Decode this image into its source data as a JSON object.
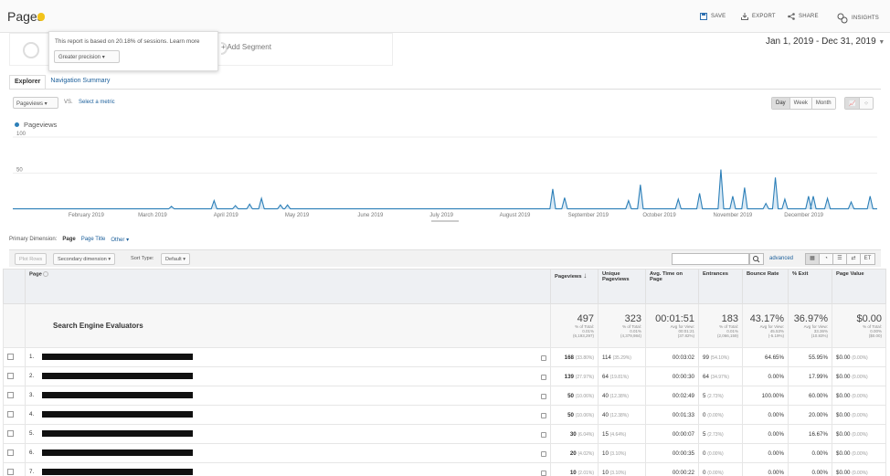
{
  "header": {
    "title": "Pages",
    "actions": [
      "SAVE",
      "EXPORT",
      "SHARE",
      "INSIGHTS"
    ]
  },
  "segment": {
    "popup_text": "This report is based on 20.18% of sessions. Learn more",
    "precision_label": "Greater precision",
    "add_segment": "+ Add Segment"
  },
  "date_range": "Jan 1, 2019 - Dec 31, 2019",
  "tabs": [
    "Explorer",
    "Navigation Summary"
  ],
  "metric_select": {
    "value": "Pageviews",
    "vs": "VS.",
    "select_metric": "Select a metric"
  },
  "time_buttons": [
    "Day",
    "Week",
    "Month"
  ],
  "legend": "Pageviews",
  "chart_data": {
    "type": "line",
    "series": [
      {
        "name": "Pageviews"
      }
    ],
    "ylim": [
      0,
      100
    ],
    "yticks": [
      "100",
      "50"
    ],
    "month_labels": [
      "February 2019",
      "March 2019",
      "April 2019",
      "May 2019",
      "June 2019",
      "July 2019",
      "August 2019",
      "September 2019",
      "October 2019",
      "November 2019",
      "December 2019"
    ],
    "spikes": [
      {
        "day": 67,
        "value": 4
      },
      {
        "day": 85,
        "value": 12
      },
      {
        "day": 94,
        "value": 5
      },
      {
        "day": 100,
        "value": 7
      },
      {
        "day": 105,
        "value": 15
      },
      {
        "day": 113,
        "value": 6
      },
      {
        "day": 116,
        "value": 6
      },
      {
        "day": 228,
        "value": 28
      },
      {
        "day": 233,
        "value": 16
      },
      {
        "day": 260,
        "value": 12
      },
      {
        "day": 265,
        "value": 34
      },
      {
        "day": 281,
        "value": 14
      },
      {
        "day": 290,
        "value": 22
      },
      {
        "day": 299,
        "value": 55
      },
      {
        "day": 304,
        "value": 18
      },
      {
        "day": 309,
        "value": 30
      },
      {
        "day": 318,
        "value": 8
      },
      {
        "day": 322,
        "value": 44
      },
      {
        "day": 326,
        "value": 14
      },
      {
        "day": 336,
        "value": 18
      },
      {
        "day": 338,
        "value": 18
      },
      {
        "day": 344,
        "value": 15
      },
      {
        "day": 354,
        "value": 10
      },
      {
        "day": 362,
        "value": 18
      }
    ]
  },
  "dimension_row": {
    "label": "Primary Dimension:",
    "options": [
      "Page",
      "Page Title",
      "Other ▾"
    ]
  },
  "toolbar": {
    "plot_rows": "Plot Rows",
    "secondary_dimension": "Secondary dimension ▾",
    "sort_type_label": "Sort Type:",
    "sort_type_value": "Default ▾",
    "advanced": "advanced"
  },
  "table": {
    "columns": [
      "Page",
      "Pageviews",
      "Unique Pageviews",
      "Avg. Time on Page",
      "Entrances",
      "Bounce Rate",
      "% Exit",
      "Page Value"
    ],
    "total_label": "Search Engine Evaluators",
    "totals": [
      {
        "value": "497",
        "sub1": "% of Total:",
        "sub2": "0.01%",
        "sub3": "(6,193,297)"
      },
      {
        "value": "323",
        "sub1": "% of Total:",
        "sub2": "0.01%",
        "sub3": "(4,379,984)"
      },
      {
        "value": "00:01:51",
        "sub1": "Avg for View:",
        "sub2": "00:01:21",
        "sub3": "(37.82%)"
      },
      {
        "value": "183",
        "sub1": "% of Total:",
        "sub2": "0.01%",
        "sub3": "(2,066,159)"
      },
      {
        "value": "43.17%",
        "sub1": "Avg for View:",
        "sub2": "45.53%",
        "sub3": "(-5.19%)"
      },
      {
        "value": "36.97%",
        "sub1": "Avg for View:",
        "sub2": "33.36%",
        "sub3": "(10.83%)"
      },
      {
        "value": "$0.00",
        "sub1": "% of Total:",
        "sub2": "0.00%",
        "sub3": "($0.00)"
      }
    ],
    "rows": [
      {
        "n": "1.",
        "pv": "168",
        "pvp": "(33.80%)",
        "upv": "114",
        "upvp": "(35.29%)",
        "time": "00:03:02",
        "ent": "99",
        "entp": "(54.10%)",
        "bounce": "64.65%",
        "exit": "55.95%",
        "val": "$0.00",
        "valp": "(0.00%)"
      },
      {
        "n": "2.",
        "pv": "139",
        "pvp": "(27.97%)",
        "upv": "64",
        "upvp": "(19.81%)",
        "time": "00:00:30",
        "ent": "64",
        "entp": "(34.97%)",
        "bounce": "0.00%",
        "exit": "17.99%",
        "val": "$0.00",
        "valp": "(0.00%)"
      },
      {
        "n": "3.",
        "pv": "50",
        "pvp": "(10.06%)",
        "upv": "40",
        "upvp": "(12.38%)",
        "time": "00:02:49",
        "ent": "5",
        "entp": "(2.73%)",
        "bounce": "100.00%",
        "exit": "60.00%",
        "val": "$0.00",
        "valp": "(0.00%)"
      },
      {
        "n": "4.",
        "pv": "50",
        "pvp": "(10.06%)",
        "upv": "40",
        "upvp": "(12.38%)",
        "time": "00:01:33",
        "ent": "0",
        "entp": "(0.00%)",
        "bounce": "0.00%",
        "exit": "20.00%",
        "val": "$0.00",
        "valp": "(0.00%)"
      },
      {
        "n": "5.",
        "pv": "30",
        "pvp": "(6.04%)",
        "upv": "15",
        "upvp": "(4.64%)",
        "time": "00:00:07",
        "ent": "5",
        "entp": "(2.73%)",
        "bounce": "0.00%",
        "exit": "16.67%",
        "val": "$0.00",
        "valp": "(0.00%)"
      },
      {
        "n": "6.",
        "pv": "20",
        "pvp": "(4.02%)",
        "upv": "10",
        "upvp": "(3.10%)",
        "time": "00:00:35",
        "ent": "0",
        "entp": "(0.00%)",
        "bounce": "0.00%",
        "exit": "0.00%",
        "val": "$0.00",
        "valp": "(0.00%)"
      },
      {
        "n": "7.",
        "pv": "10",
        "pvp": "(2.01%)",
        "upv": "10",
        "upvp": "(3.10%)",
        "time": "00:00:22",
        "ent": "0",
        "entp": "(0.00%)",
        "bounce": "0.00%",
        "exit": "0.00%",
        "val": "$0.00",
        "valp": "(0.00%)"
      }
    ]
  }
}
